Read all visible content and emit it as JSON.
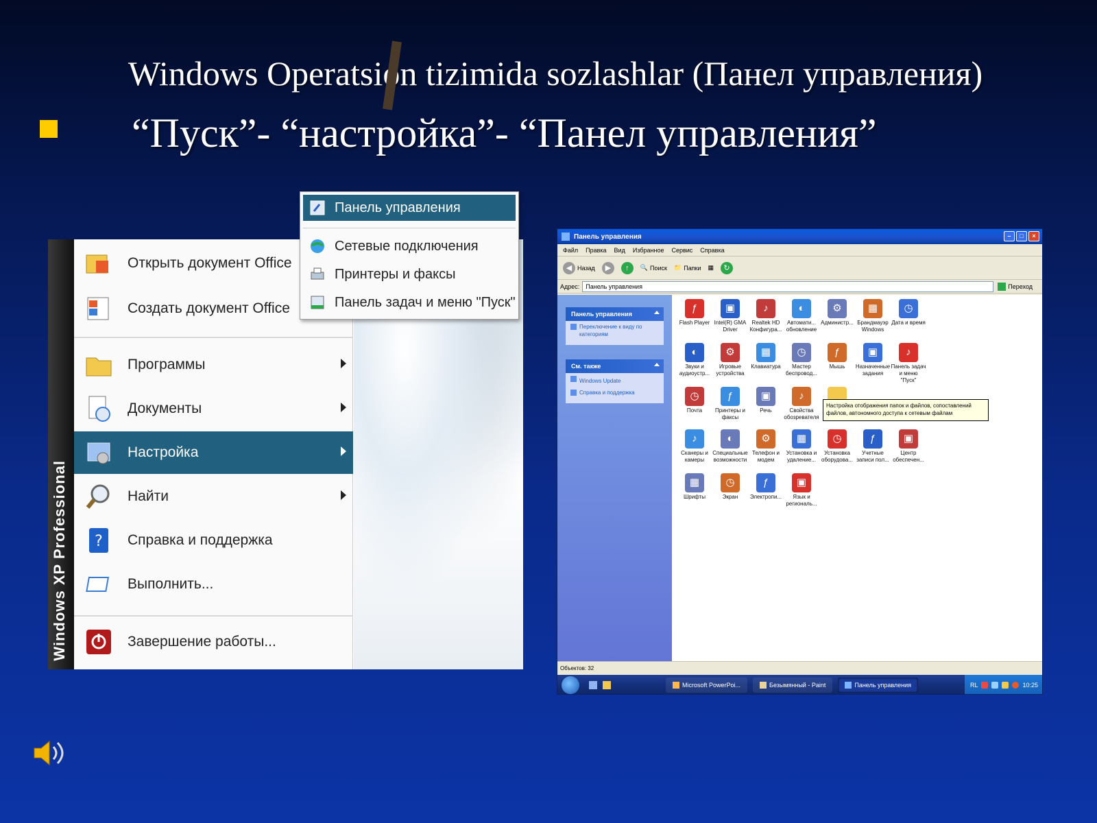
{
  "slide": {
    "title": "Windows Operatsion tizimida sozlashlar   (Панел управления)",
    "bullet": "“Пуск”- “настройка”- “Панел управления”"
  },
  "start_menu": {
    "brand": "Windows XP Professional",
    "items": [
      {
        "label": "Открыть документ Office",
        "icon": "office-open-icon"
      },
      {
        "label": "Создать документ Office",
        "icon": "office-new-icon"
      },
      {
        "label": "Программы",
        "icon": "folder-icon",
        "submenu": true
      },
      {
        "label": "Документы",
        "icon": "documents-icon",
        "submenu": true
      },
      {
        "label": "Настройка",
        "icon": "settings-icon",
        "submenu": true,
        "active": true
      },
      {
        "label": "Найти",
        "icon": "search-icon",
        "submenu": true
      },
      {
        "label": "Справка и поддержка",
        "icon": "help-icon"
      },
      {
        "label": "Выполнить...",
        "icon": "run-icon"
      },
      {
        "label": "Завершение работы...",
        "icon": "power-icon"
      }
    ],
    "submenu": [
      {
        "label": "Панель управления",
        "active": true
      },
      {
        "label": "Сетевые подключения"
      },
      {
        "label": "Принтеры и факсы"
      },
      {
        "label": "Панель задач и меню \"Пуск\""
      }
    ]
  },
  "control_panel": {
    "window_title": "Панель управления",
    "menus": [
      "Файл",
      "Правка",
      "Вид",
      "Избранное",
      "Сервис",
      "Справка"
    ],
    "toolbar": {
      "back": "Назад",
      "search": "Поиск",
      "folders": "Папки"
    },
    "address_label": "Адрес:",
    "address_value": "Панель управления",
    "go_label": "Переход",
    "left_panel": {
      "box1_title": "Панель управления",
      "box1_link": "Переключение к виду по категориям",
      "box2_title": "См. также",
      "box2_links": [
        "Windows Update",
        "Справка и поддержка"
      ]
    },
    "icons": [
      [
        "Flash Player",
        "Intel(R) GMA Driver",
        "Realtek HD Конфигура...",
        "Автомати... обновление",
        "Администр...",
        "Брандмауэр Windows",
        "Дата и время"
      ],
      [
        "Звуки и аудиоустр...",
        "Игровые устройства",
        "Клавиатура",
        "Мастер беспровод...",
        "Мышь",
        "Назначенные задания",
        "Панель задач и меню \"Пуск\""
      ],
      [
        "Почта",
        "Принтеры и факсы",
        "Речь",
        "Свойства обозревателя",
        "",
        "",
        ""
      ],
      [
        "Сканеры и камеры",
        "Специальные возможности",
        "Телефон и модем",
        "Установка и удаление...",
        "Установка оборудова...",
        "Учетные записи пол...",
        "Центр обеспечен..."
      ],
      [
        "Шрифты",
        "Экран",
        "Электропи...",
        "Язык и региональ...",
        "",
        "",
        ""
      ]
    ],
    "tooltip": "Настройка отображения папок и файлов, сопоставлений файлов, автономного доступа к сетевым файлам",
    "status": "Объектов: 32",
    "taskbar": {
      "tasks": [
        "Microsoft PowerPoi...",
        "Безымянный - Paint",
        "Панель управления"
      ],
      "lang": "RL",
      "clock": "10:25"
    }
  },
  "colors": {
    "bullet": "#ffcc00",
    "menu_highlight": "#21607f",
    "xp_blue": "#215dc6"
  }
}
